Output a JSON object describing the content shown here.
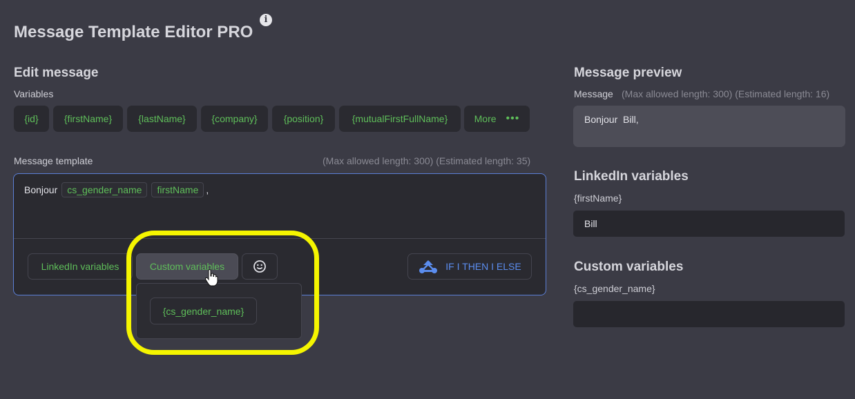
{
  "app": {
    "title": "Message Template Editor PRO",
    "info_icon": "info-icon"
  },
  "edit": {
    "heading": "Edit message",
    "variables_label": "Variables",
    "variables": [
      "{id}",
      "{firstName}",
      "{lastName}",
      "{company}",
      "{position}",
      "{mutualFirstFullName}"
    ],
    "more_label": "More",
    "more_icon": "•••",
    "template_label": "Message template",
    "template_meta": "(Max allowed length: 300) (Estimated length: 35)",
    "template": {
      "prefix": "Bonjour",
      "tag1": "cs_gender_name",
      "tag2": "firstName",
      "suffix": ","
    },
    "toolbar": {
      "linkedin_label": "LinkedIn variables",
      "custom_label": "Custom variables",
      "emoji_icon": "smiley-icon",
      "ifthen_label": "IF I THEN I ELSE"
    },
    "dropdown": {
      "items": [
        "{cs_gender_name}"
      ]
    }
  },
  "preview": {
    "heading": "Message preview",
    "message_label": "Message",
    "message_meta": "(Max allowed length: 300) (Estimated length: 16)",
    "message_text": "Bonjour  Bill,",
    "linkedin_heading": "LinkedIn variables",
    "linkedin_var_label": "{firstName}",
    "linkedin_var_value": "Bill",
    "custom_heading": "Custom variables",
    "custom_var_label": "{cs_gender_name}",
    "custom_var_value": ""
  },
  "colors": {
    "background": "#3b3b45",
    "accent_green": "#5fbf5a",
    "accent_blue": "#5b8def",
    "highlight_yellow": "#f5f500"
  }
}
